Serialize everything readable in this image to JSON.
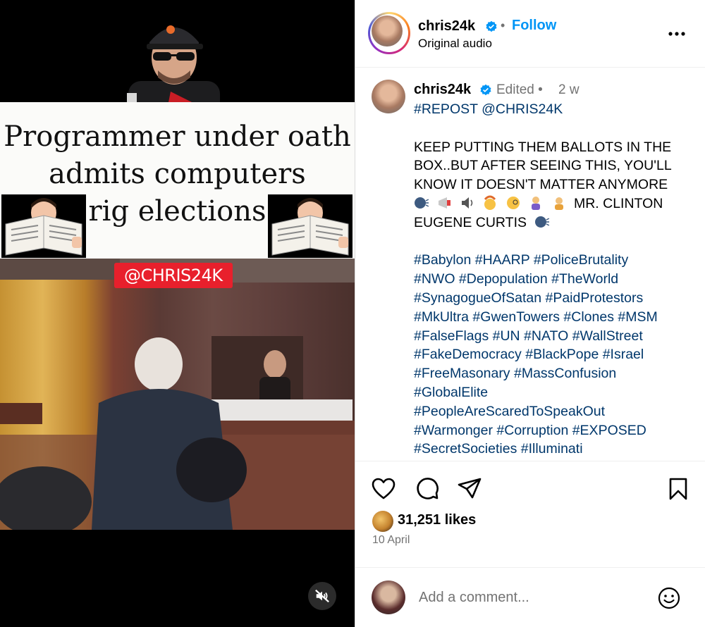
{
  "media": {
    "title_lines": [
      "Programmer under oath",
      "admits computers",
      "rig elections"
    ],
    "watermark": "@CHRIS24K",
    "mute_icon": "speaker-muted-icon"
  },
  "header": {
    "username": "chris24k",
    "separator": "•",
    "follow_label": "Follow",
    "subtitle": "Original audio",
    "more_icon": "more-horizontal-icon"
  },
  "caption": {
    "username": "chris24k",
    "edited": "Edited",
    "separator": "•",
    "time": "2 w",
    "mention_line": "#REPOST @CHRIS24K",
    "body_lines": [
      "KEEP PUTTING THEM BALLOTS IN THE",
      "BOX..BUT AFTER SEEING THIS, YOU'LL",
      "KNOW IT DOESN'T MATTER ANYMORE"
    ],
    "emoji_line_text": "MR. CLINTON",
    "last_line": "EUGENE CURTIS",
    "emojis": [
      "speaking-head-emoji",
      "megaphone-emoji",
      "speaker-emoji",
      "exploding-head-emoji",
      "monocle-face-emoji",
      "person-shrugging-emoji",
      "person-facepalming-emoji"
    ],
    "hashtag_lines": [
      "#Babylon #HAARP #PoliceBrutality",
      "#NWO #Depopulation #TheWorld",
      "#SynagogueOfSatan #PaidProtestors",
      "#MkUltra #GwenTowers #Clones #MSM",
      "#FalseFlags #UN #NATO #WallStreet",
      "#FakeDemocracy #BlackPope #Israel",
      "#FreeMasonary #MassConfusion",
      "#GlobalElite",
      "#PeopleAreScaredToSpeakOut",
      "#Warmonger #Corruption #EXPOSED",
      "#SecretSocieties #Illuminati"
    ]
  },
  "actions": {
    "like_icon": "heart-icon",
    "comment_icon": "comment-icon",
    "share_icon": "share-icon",
    "save_icon": "bookmark-icon"
  },
  "likes": {
    "count_text": "31,251 likes"
  },
  "date": "10 April",
  "comment": {
    "placeholder": "Add a comment...",
    "emoji_icon": "smiley-icon"
  },
  "colors": {
    "link": "#0095f6",
    "hashtag": "#00376b",
    "muted": "#737373",
    "verified": "#0095f6",
    "watermark": "#e8202c"
  }
}
